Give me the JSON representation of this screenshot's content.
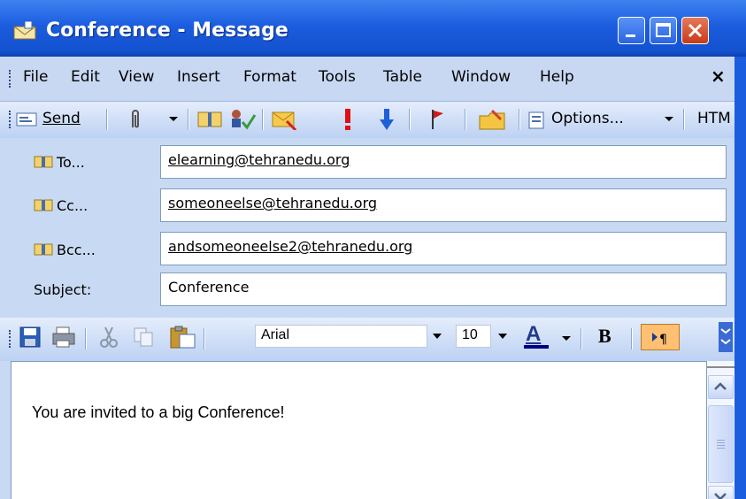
{
  "window": {
    "title": "Conference - Message"
  },
  "menu": {
    "items": [
      "File",
      "Edit",
      "View",
      "Insert",
      "Format",
      "Tools",
      "Table",
      "Window",
      "Help"
    ],
    "close_glyph": "×"
  },
  "toolbar": {
    "send_label": "Send",
    "options_label": "Options...",
    "format_label": "HTM",
    "icons": [
      "send-icon",
      "attach-icon",
      "address-book-icon",
      "check-names-icon",
      "importance-low-icon",
      "importance-high-icon",
      "down-arrow-icon",
      "flag-icon",
      "folder-icon",
      "options-icon"
    ]
  },
  "header": {
    "to_label": "To...",
    "cc_label": "Cc...",
    "bcc_label": "Bcc...",
    "subject_label": "Subject:",
    "to_value": "elearning@tehranedu.org",
    "cc_value": "someoneelse@tehranedu.org",
    "bcc_value": "andsomeoneelse2@tehranedu.org",
    "subject_value": "Conference"
  },
  "format_toolbar": {
    "font": "Arial",
    "size": "10",
    "bold_glyph": "B",
    "color_glyph": "A",
    "font_color": "#000080"
  },
  "body": {
    "text": "You are invited to a big Conference!"
  },
  "colors": {
    "titlebar": "#1b5ddf",
    "menubar": "#c9d8f2",
    "accent_toggle": "#ffc074"
  }
}
